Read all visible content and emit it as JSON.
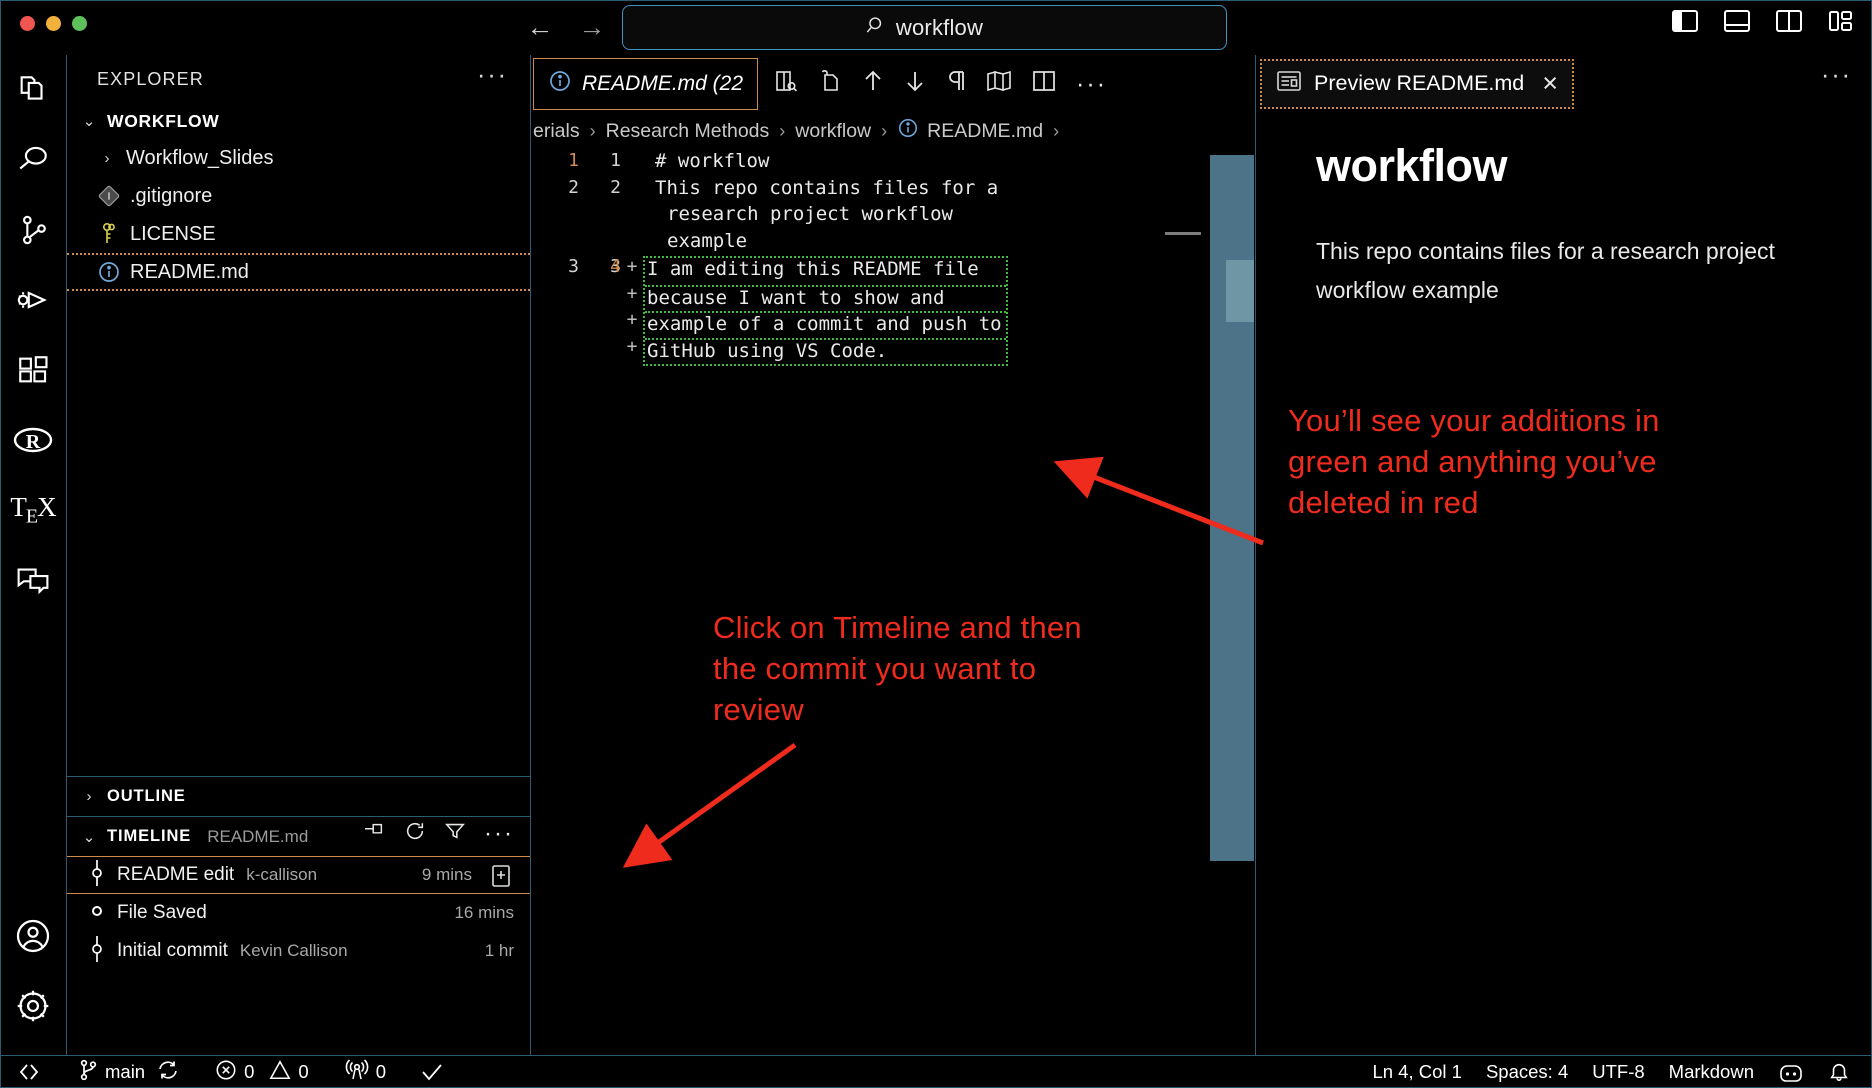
{
  "titlebar": {
    "window_controls": [
      "close",
      "minimize",
      "zoom"
    ],
    "back_arrow": "←",
    "forward_arrow": "→",
    "command_center": {
      "icon": "search-icon",
      "value": "workflow"
    },
    "layout_toggles": [
      "toggle-primary-sidebar",
      "toggle-panel",
      "toggle-secondary-sidebar",
      "customize-layout"
    ]
  },
  "activitybar": {
    "items": [
      {
        "icon": "explorer-files-icon",
        "label": "Explorer"
      },
      {
        "icon": "search-icon",
        "label": "Search"
      },
      {
        "icon": "source-control-icon",
        "label": "Source Control"
      },
      {
        "icon": "run-and-debug-icon",
        "label": "Run and Debug"
      },
      {
        "icon": "extensions-icon",
        "label": "Extensions"
      },
      {
        "icon": "r-language-icon",
        "label": "R"
      },
      {
        "icon": "tex-icon",
        "label": "TeX"
      },
      {
        "icon": "chat-icon",
        "label": "Chat"
      }
    ],
    "bottom_items": [
      {
        "icon": "account-icon",
        "label": "Accounts"
      },
      {
        "icon": "gear-icon",
        "label": "Manage"
      }
    ]
  },
  "sidebar": {
    "title": "EXPLORER",
    "more_actions": "···",
    "root": {
      "label": "WORKFLOW",
      "expanded": true
    },
    "files": [
      {
        "label": "Workflow_Slides",
        "icon": "folder-chevron-icon",
        "type": "folder",
        "selected": false
      },
      {
        "label": ".gitignore",
        "icon": "git-file-icon",
        "type": "file",
        "selected": false
      },
      {
        "label": "LICENSE",
        "icon": "license-key-icon",
        "type": "file",
        "selected": false
      },
      {
        "label": "README.md",
        "icon": "markdown-info-icon",
        "type": "file",
        "selected": true
      }
    ],
    "outline": {
      "label": "OUTLINE",
      "expanded": false
    },
    "timeline": {
      "label": "TIMELINE",
      "subtitle": "README.md",
      "expanded": true,
      "actions": [
        "pin-icon",
        "refresh-icon",
        "filter-icon",
        "more-icon"
      ],
      "entries": [
        {
          "label": "README edit",
          "author": "k-callison",
          "time": "9 mins",
          "icon": "commit-icon",
          "badge": "diff-icon",
          "selected": true
        },
        {
          "label": "File Saved",
          "author": "",
          "time": "16 mins",
          "icon": "save-dot-icon",
          "badge": "",
          "selected": false
        },
        {
          "label": "Initial commit",
          "author": "Kevin Callison",
          "time": "1 hr",
          "icon": "commit-icon",
          "badge": "",
          "selected": false
        }
      ]
    }
  },
  "editor": {
    "tab": {
      "label": "README.md (22",
      "icon": "markdown-info-icon"
    },
    "tab_actions": [
      "split-diff-icon",
      "open-changes-icon",
      "previous-change-icon",
      "next-change-icon",
      "pilcrow-icon",
      "minimap-icon",
      "split-editor-icon",
      "more-actions-icon"
    ],
    "breadcrumbs": [
      "erials",
      "Research Methods",
      "workflow",
      "README.md",
      ""
    ],
    "breadcrumb_icon": "markdown-info-icon",
    "diff": {
      "lines": [
        {
          "orig": "1",
          "mod": "1",
          "marker": "",
          "text": "# workflow",
          "kind": "heading",
          "current": true
        },
        {
          "orig": "2",
          "mod": "2",
          "marker": "",
          "text": "This repo contains files for a",
          "kind": "context"
        },
        {
          "orig": "",
          "mod": "",
          "marker": "",
          "text": "research project workflow",
          "kind": "wrap"
        },
        {
          "orig": "",
          "mod": "",
          "marker": "",
          "text": "example",
          "kind": "wrap"
        },
        {
          "orig": "3",
          "mod": "3",
          "marker": "",
          "text": "",
          "kind": "context"
        }
      ],
      "added": [
        {
          "mod": "4",
          "marker": "+",
          "text": "I am editing this README file"
        },
        {
          "mod": "",
          "marker": "+",
          "text": "because I want to show and"
        },
        {
          "mod": "",
          "marker": "+",
          "text": "example of a commit and push to"
        },
        {
          "mod": "",
          "marker": "+",
          "text": "GitHub using VS Code."
        }
      ]
    }
  },
  "preview": {
    "tab": {
      "label": "Preview README.md",
      "icon": "preview-icon",
      "close": "×"
    },
    "more_actions": "···",
    "heading": "workflow",
    "paragraph": "This repo contains files for a research project workflow example"
  },
  "annotations": [
    {
      "id": "anno-green",
      "text": "You’ll see your additions in green and anything you’ve deleted in red",
      "color": "#ee2b1c"
    },
    {
      "id": "anno-timeline",
      "text": "Click on Timeline and then the commit you want to review",
      "color": "#ee2b1c"
    }
  ],
  "statusbar": {
    "remote_icon": "remote-window-icon",
    "branch": {
      "icon": "git-branch-icon",
      "label": "main",
      "sync_icon": "sync-icon"
    },
    "errors": {
      "icon": "error-icon",
      "count": "0"
    },
    "warnings": {
      "icon": "warning-icon",
      "count": "0"
    },
    "ports": {
      "icon": "radio-tower-icon",
      "count": "0"
    },
    "check_icon": "check-icon",
    "position": "Ln 4, Col 1",
    "indent": "Spaces: 4",
    "encoding": "UTF-8",
    "language": "Markdown",
    "copilot_icon": "copilot-icon",
    "bell_icon": "bell-icon"
  },
  "colors": {
    "accent_border": "#2c5c74",
    "focus_orange": "#d08b4a",
    "added_green": "#3fbb3f",
    "annotation_red": "#ee2b1c",
    "overview_ruler": "#4c7388",
    "heading_blue": "#569cd6"
  }
}
